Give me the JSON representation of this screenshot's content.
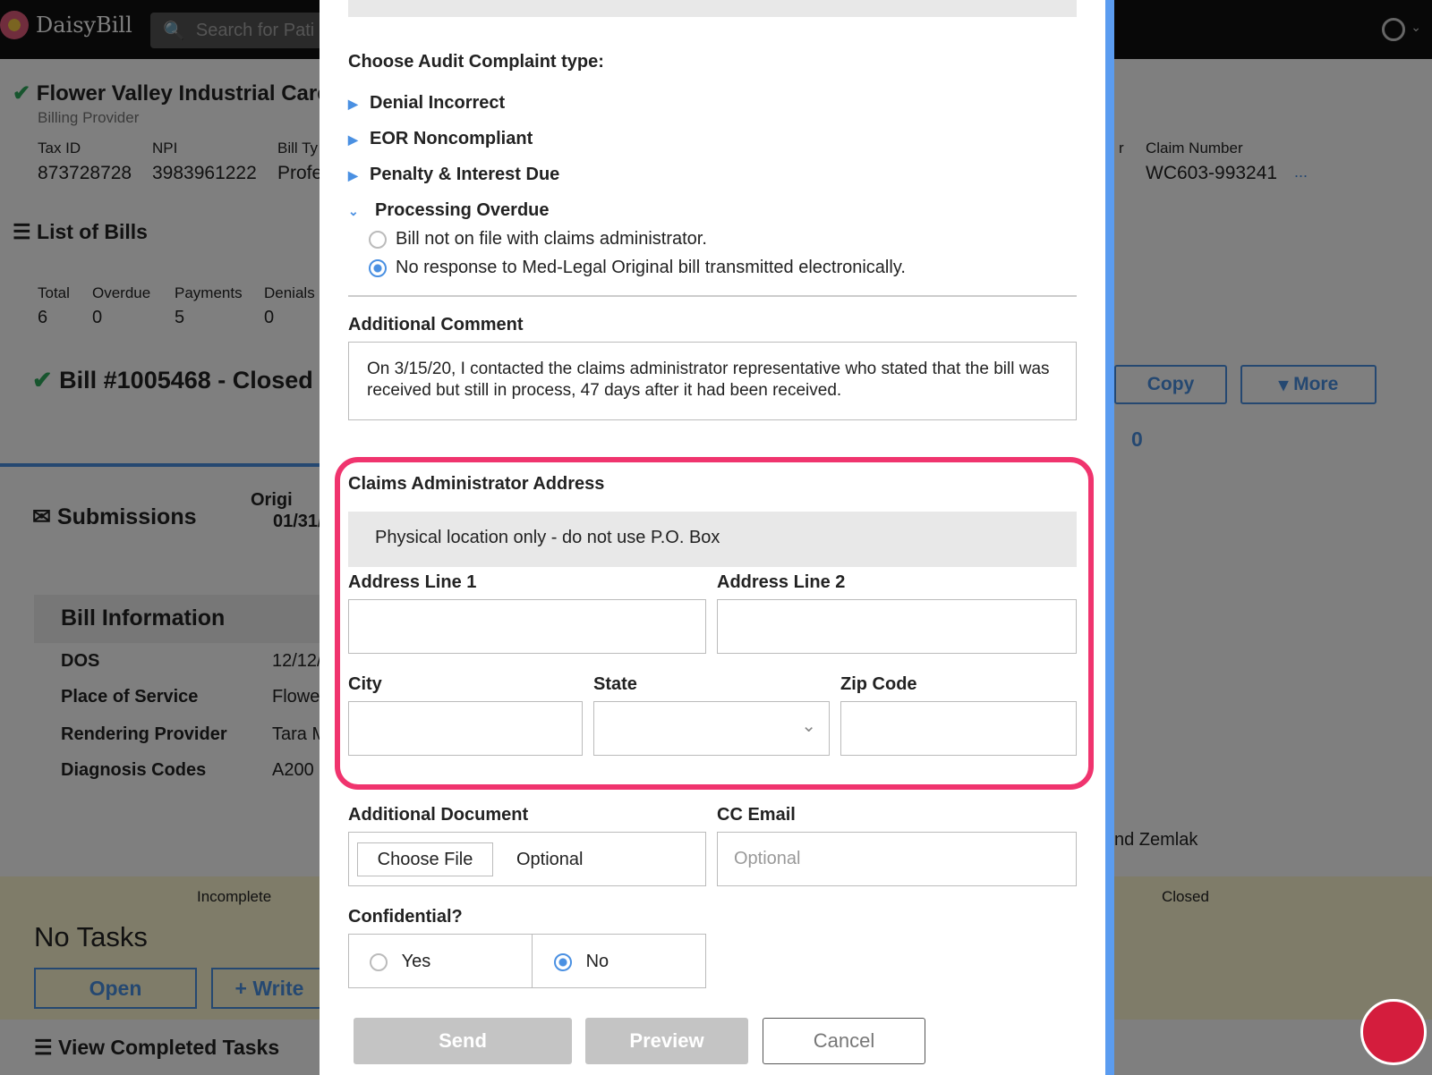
{
  "app": {
    "name": "DaisyBill",
    "search_placeholder": "Search for Pati"
  },
  "provider": {
    "name": "Flower Valley Industrial Care",
    "role": "Billing Provider",
    "tax_id_label": "Tax ID",
    "tax_id": "873728728",
    "npi_label": "NPI",
    "npi": "3983961222",
    "bill_type_label": "Bill Ty",
    "bill_type": "Profe",
    "partial_label": "r",
    "claim_label": "Claim Number",
    "claim_number": "WC603-993241",
    "ellipsis": "..."
  },
  "bills": {
    "title": "List of Bills",
    "stats": [
      {
        "label": "Total",
        "value": "6"
      },
      {
        "label": "Overdue",
        "value": "0"
      },
      {
        "label": "Payments",
        "value": "5"
      },
      {
        "label": "Denials",
        "value": "0"
      }
    ]
  },
  "bill": {
    "title": "Bill #1005468 - Closed",
    "copy": "Copy",
    "more": "More",
    "count": "0"
  },
  "submissions": {
    "title": "Submissions",
    "orig": "Origi",
    "orig_date": "01/31/"
  },
  "bill_info": {
    "title": "Bill Information",
    "rows": [
      {
        "label": "DOS",
        "value": "12/12/"
      },
      {
        "label": "Place of Service",
        "value": "Flowe"
      },
      {
        "label": "Rendering Provider",
        "value": "Tara M"
      },
      {
        "label": "Diagnosis Codes",
        "value": "A200"
      }
    ]
  },
  "tasks": {
    "status_left": "Incomplete",
    "status_right": "Closed",
    "title": "No Tasks",
    "open": "Open",
    "write": "Write",
    "view_completed": "View Completed Tasks",
    "partial_name": "nd Zemlak"
  },
  "modal": {
    "complaint_label": "Choose Audit Complaint type:",
    "types": [
      "Denial Incorrect",
      "EOR Noncompliant",
      "Penalty & Interest Due"
    ],
    "expanded_type": "Processing Overdue",
    "options": [
      "Bill not on file with claims administrator.",
      "No response to Med-Legal Original bill transmitted electronically."
    ],
    "comment_label": "Additional Comment",
    "comment_text": "On 3/15/20, I contacted the claims administrator representative who stated that the bill was received but still in process, 47 days after it had been received.",
    "address_title": "Claims Administrator Address",
    "address_note": "Physical location only - do not use P.O. Box",
    "addr1": "Address Line 1",
    "addr2": "Address Line 2",
    "city": "City",
    "state": "State",
    "zip": "Zip Code",
    "doc_label": "Additional Document",
    "choose_file": "Choose File",
    "doc_optional": "Optional",
    "cc_label": "CC Email",
    "cc_placeholder": "Optional",
    "conf_label": "Confidential?",
    "yes": "Yes",
    "no": "No",
    "send": "Send",
    "preview": "Preview",
    "cancel": "Cancel"
  },
  "colors": {
    "accent": "#4a90e2",
    "highlight": "#f0346e",
    "green": "#2eaa5c"
  }
}
